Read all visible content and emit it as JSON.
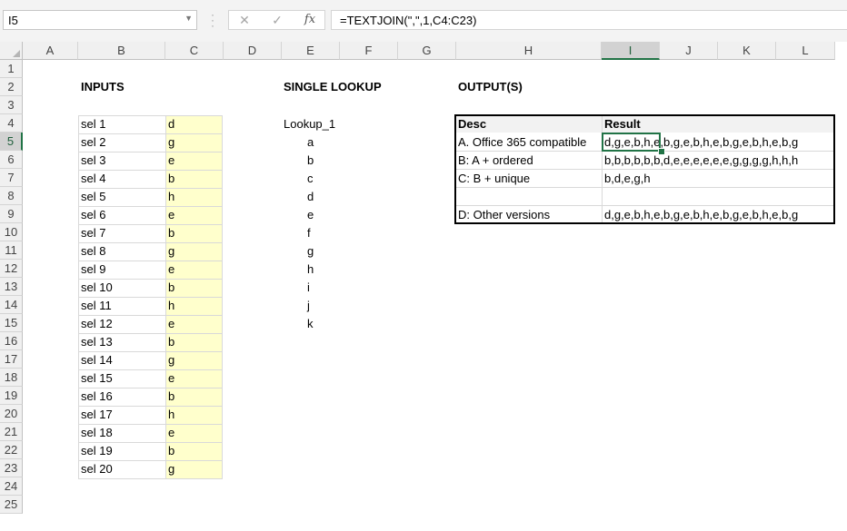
{
  "formula_bar": {
    "name_box": "I5",
    "formula": "=TEXTJOIN(\",\",1,C4:C23)",
    "cancel_icon": "✕",
    "enter_icon": "✓",
    "fx_label": "fx"
  },
  "columns": [
    "A",
    "B",
    "C",
    "D",
    "E",
    "F",
    "G",
    "H",
    "I",
    "J",
    "K",
    "L"
  ],
  "rows": [
    "1",
    "2",
    "3",
    "4",
    "5",
    "6",
    "7",
    "8",
    "9",
    "10",
    "11",
    "12",
    "13",
    "14",
    "15",
    "16",
    "17",
    "18",
    "19",
    "20",
    "21",
    "22",
    "23",
    "24",
    "25"
  ],
  "selected_cell": {
    "column": "I",
    "row": "5"
  },
  "inputs": {
    "title": "INPUTS",
    "items": [
      {
        "label": "sel 1",
        "value": "d"
      },
      {
        "label": "sel 2",
        "value": "g"
      },
      {
        "label": "sel 3",
        "value": "e"
      },
      {
        "label": "sel 4",
        "value": "b"
      },
      {
        "label": "sel 5",
        "value": "h"
      },
      {
        "label": "sel 6",
        "value": "e"
      },
      {
        "label": "sel 7",
        "value": "b"
      },
      {
        "label": "sel 8",
        "value": "g"
      },
      {
        "label": "sel 9",
        "value": "e"
      },
      {
        "label": "sel 10",
        "value": "b"
      },
      {
        "label": "sel 11",
        "value": "h"
      },
      {
        "label": "sel 12",
        "value": "e"
      },
      {
        "label": "sel 13",
        "value": "b"
      },
      {
        "label": "sel 14",
        "value": "g"
      },
      {
        "label": "sel 15",
        "value": "e"
      },
      {
        "label": "sel 16",
        "value": "b"
      },
      {
        "label": "sel 17",
        "value": "h"
      },
      {
        "label": "sel 18",
        "value": "e"
      },
      {
        "label": "sel 19",
        "value": "b"
      },
      {
        "label": "sel 20",
        "value": "g"
      }
    ]
  },
  "lookup": {
    "title": "SINGLE LOOKUP",
    "header": "Lookup_1",
    "values": [
      "a",
      "b",
      "c",
      "d",
      "e",
      "f",
      "g",
      "h",
      "i",
      "j",
      "k"
    ]
  },
  "outputs": {
    "title": "OUTPUT(S)",
    "desc_header": "Desc",
    "result_header": "Result",
    "rows": [
      {
        "desc": "A. Office 365 compatible",
        "result": "d,g,e,b,h,e,b,g,e,b,h,e,b,g,e,b,h,e,b,g"
      },
      {
        "desc": "B: A + ordered",
        "result": "b,b,b,b,b,b,d,e,e,e,e,e,e,g,g,g,g,h,h,h"
      },
      {
        "desc": "C: B + unique",
        "result": "b,d,e,g,h"
      },
      {
        "desc": "",
        "result": ""
      },
      {
        "desc": "D: Other versions",
        "result": "d,g,e,b,h,e,b,g,e,b,h,e,b,g,e,b,h,e,b,g"
      }
    ]
  },
  "colors": {
    "selection": "#217346",
    "input_fill": "#ffffcc",
    "header_fill": "#f2f2f2"
  }
}
